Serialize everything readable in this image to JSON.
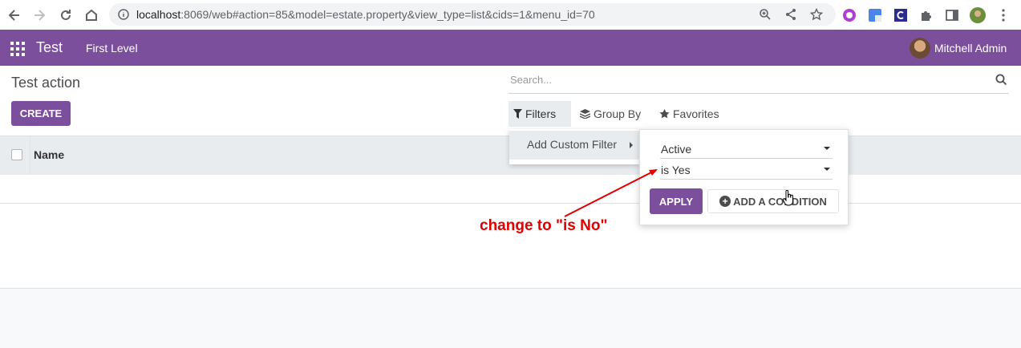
{
  "browser": {
    "url_host": "localhost",
    "url_rest": ":8069/web#action=85&model=estate.property&view_type=list&cids=1&menu_id=70"
  },
  "topbar": {
    "app_name": "Test",
    "menu_item": "First Level",
    "user_name": "Mitchell Admin"
  },
  "page": {
    "title": "Test action",
    "create_label": "CREATE",
    "search_placeholder": "Search..."
  },
  "search_panel": {
    "filters_label": "Filters",
    "groupby_label": "Group By",
    "favorites_label": "Favorites"
  },
  "list": {
    "columns": [
      "Name"
    ]
  },
  "filters_menu": {
    "item": "Add Custom Filter"
  },
  "custom_filter": {
    "field_value": "Active",
    "operator_value": "is Yes",
    "apply_label": "APPLY",
    "add_condition_label": "ADD A CONDITION"
  },
  "annotation": {
    "text": "change to \"is No\"",
    "color": "#e00000"
  },
  "colors": {
    "brand": "#7c4f9c"
  }
}
